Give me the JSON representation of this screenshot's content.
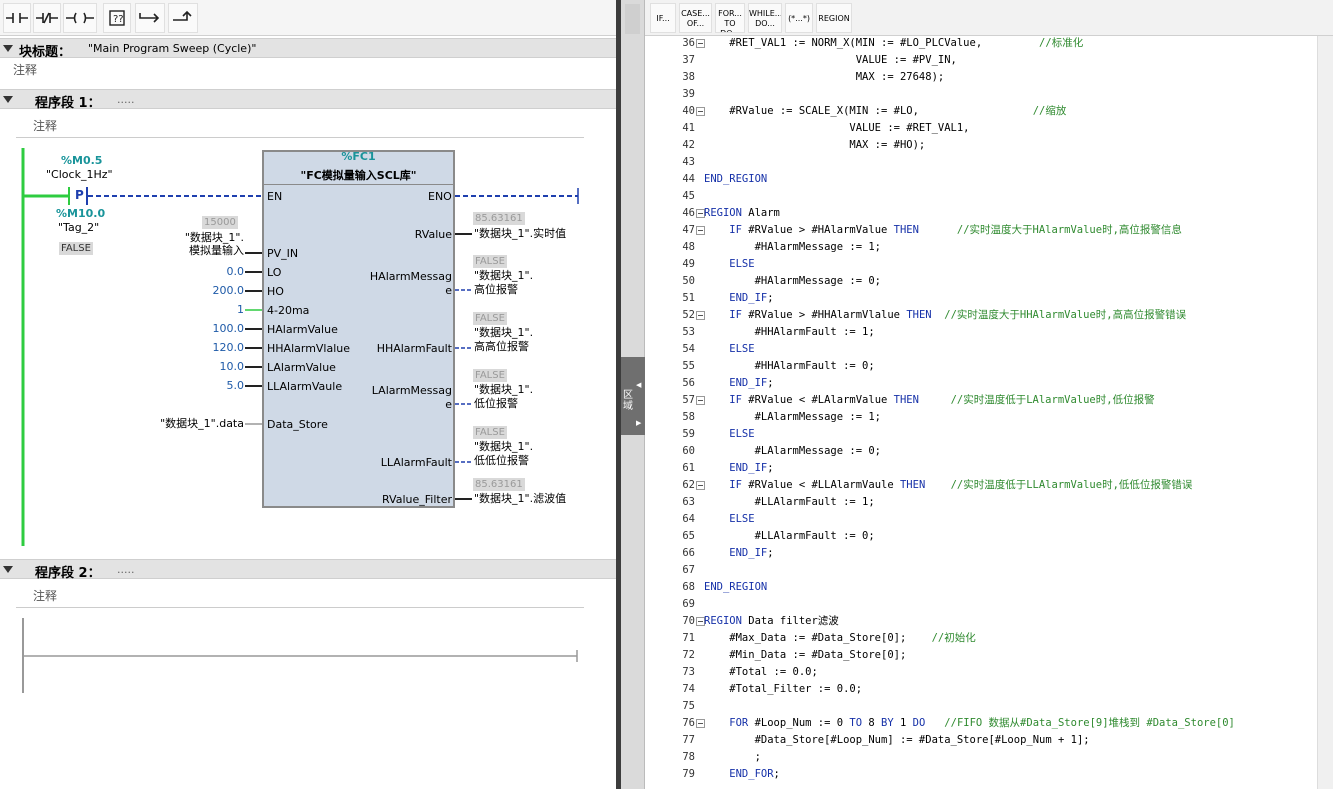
{
  "ladder_toolbar": {
    "icons": [
      "no-contact-icon",
      "nc-contact-icon",
      "coil-icon",
      "empty-box-icon",
      "branch-open-icon",
      "branch-close-icon"
    ]
  },
  "block_title": {
    "label": "块标题：",
    "value": "\"Main Program Sweep (Cycle)\"",
    "comment": "注释"
  },
  "network1": {
    "label": "程序段 1：",
    "dots": ".....",
    "comment": "注释",
    "contact": {
      "address": "%M0.5",
      "name": "\"Clock_1Hz\"",
      "type": "P"
    },
    "edge_mem": {
      "address": "%M10.0",
      "name": "\"Tag_2\"",
      "state": "FALSE"
    },
    "fc": {
      "address": "%FC1",
      "name": "\"FC模拟量输入SCL库\"",
      "en": "EN",
      "eno": "ENO",
      "inputs": [
        {
          "pin": "PV_IN",
          "value_line1": "\"数据块_1\".",
          "value_line2": "模拟量输入",
          "live": "15000"
        },
        {
          "pin": "LO",
          "value": "0.0"
        },
        {
          "pin": "HO",
          "value": "200.0"
        },
        {
          "pin": "4-20ma",
          "value": "1"
        },
        {
          "pin": "HAlarmValue",
          "value": "100.0"
        },
        {
          "pin": "HHAlarmVlalue",
          "value": "120.0"
        },
        {
          "pin": "LAlarmValue",
          "value": "10.0"
        },
        {
          "pin": "LLAlarmVaule",
          "value": "5.0"
        },
        {
          "pin": "Data_Store",
          "value": "\"数据块_1\".data"
        }
      ],
      "outputs": [
        {
          "pin": "RValue",
          "live": "85.63161",
          "line1": "\"数据块_1\".实时值"
        },
        {
          "pin_line1": "HAlarmMessag",
          "pin_line2": "e",
          "live": "FALSE",
          "line1": "\"数据块_1\".",
          "line2": "高位报警"
        },
        {
          "pin": "HHAlarmFault",
          "live": "FALSE",
          "line1": "\"数据块_1\".",
          "line2": "高高位报警"
        },
        {
          "pin_line1": "LAlarmMessag",
          "pin_line2": "e",
          "live": "FALSE",
          "line1": "\"数据块_1\".",
          "line2": "低位报警"
        },
        {
          "pin": "LLAlarmFault",
          "live": "FALSE",
          "line1": "\"数据块_1\".",
          "line2": "低低位报警"
        },
        {
          "pin": "RValue_Filter",
          "live": "85.63161",
          "line1": "\"数据块_1\".滤波值"
        }
      ]
    }
  },
  "network2": {
    "label": "程序段 2：",
    "dots": ".....",
    "comment": "注释"
  },
  "splitter": {
    "label": "区域"
  },
  "scl_toolbar": {
    "buttons": [
      {
        "label1": "IF...",
        "label2": ""
      },
      {
        "label1": "CASE...",
        "label2": "OF..."
      },
      {
        "label1": "FOR...",
        "label2": "TO DO..."
      },
      {
        "label1": "WHILE...",
        "label2": "DO..."
      },
      {
        "label1": "(*...*)",
        "label2": ""
      },
      {
        "label1": "REGION",
        "label2": ""
      }
    ]
  },
  "code": [
    {
      "n": "36",
      "fold": true,
      "segs": [
        [
          "",
          "    #RET_VAL1 := NORM_X(MIN := #LO_PLCValue,         "
        ],
        [
          "cm",
          "//标准化"
        ]
      ]
    },
    {
      "n": "37",
      "segs": [
        [
          "",
          "                        VALUE := #PV_IN,"
        ]
      ]
    },
    {
      "n": "38",
      "segs": [
        [
          "",
          "                        MAX := 27648);"
        ]
      ]
    },
    {
      "n": "39",
      "segs": []
    },
    {
      "n": "40",
      "fold": true,
      "segs": [
        [
          "",
          "    #RValue := SCALE_X(MIN := #LO,                  "
        ],
        [
          "cm",
          "//缩放"
        ]
      ]
    },
    {
      "n": "41",
      "segs": [
        [
          "",
          "                       VALUE := #RET_VAL1,"
        ]
      ]
    },
    {
      "n": "42",
      "segs": [
        [
          "",
          "                       MAX := #HO);"
        ]
      ]
    },
    {
      "n": "43",
      "segs": []
    },
    {
      "n": "44",
      "segs": [
        [
          "kw",
          "END_REGION"
        ]
      ]
    },
    {
      "n": "45",
      "segs": []
    },
    {
      "n": "46",
      "fold": true,
      "segs": [
        [
          "kw",
          "REGION"
        ],
        [
          "",
          " Alarm"
        ]
      ]
    },
    {
      "n": "47",
      "fold": true,
      "segs": [
        [
          "kw",
          "    IF"
        ],
        [
          "",
          " #RValue > #HAlarmValue "
        ],
        [
          "kw",
          "THEN"
        ],
        [
          "",
          "      "
        ],
        [
          "cm",
          "//实时温度大于HAlarmValue时,高位报警信息"
        ]
      ]
    },
    {
      "n": "48",
      "segs": [
        [
          "",
          "        #HAlarmMessage := 1;"
        ]
      ]
    },
    {
      "n": "49",
      "segs": [
        [
          "kw",
          "    ELSE"
        ]
      ]
    },
    {
      "n": "50",
      "segs": [
        [
          "",
          "        #HAlarmMessage := 0;"
        ]
      ]
    },
    {
      "n": "51",
      "segs": [
        [
          "kw",
          "    END_IF"
        ],
        [
          "",
          ";"
        ]
      ]
    },
    {
      "n": "52",
      "fold": true,
      "segs": [
        [
          "kw",
          "    IF"
        ],
        [
          "",
          " #RValue > #HHAlarmVlalue "
        ],
        [
          "kw",
          "THEN"
        ],
        [
          "",
          "  "
        ],
        [
          "cm",
          "//实时温度大于HHAlarmValue时,高高位报警错误"
        ]
      ]
    },
    {
      "n": "53",
      "segs": [
        [
          "",
          "        #HHAlarmFault := 1;"
        ]
      ]
    },
    {
      "n": "54",
      "segs": [
        [
          "kw",
          "    ELSE"
        ]
      ]
    },
    {
      "n": "55",
      "segs": [
        [
          "",
          "        #HHAlarmFault := 0;"
        ]
      ]
    },
    {
      "n": "56",
      "segs": [
        [
          "kw",
          "    END_IF"
        ],
        [
          "",
          ";"
        ]
      ]
    },
    {
      "n": "57",
      "fold": true,
      "segs": [
        [
          "kw",
          "    IF"
        ],
        [
          "",
          " #RValue < #LAlarmValue "
        ],
        [
          "kw",
          "THEN"
        ],
        [
          "",
          "     "
        ],
        [
          "cm",
          "//实时温度低于LAlarmValue时,低位报警"
        ]
      ]
    },
    {
      "n": "58",
      "segs": [
        [
          "",
          "        #LAlarmMessage := 1;"
        ]
      ]
    },
    {
      "n": "59",
      "segs": [
        [
          "kw",
          "    ELSE"
        ]
      ]
    },
    {
      "n": "60",
      "segs": [
        [
          "",
          "        #LAlarmMessage := 0;"
        ]
      ]
    },
    {
      "n": "61",
      "segs": [
        [
          "kw",
          "    END_IF"
        ],
        [
          "",
          ";"
        ]
      ]
    },
    {
      "n": "62",
      "fold": true,
      "segs": [
        [
          "kw",
          "    IF"
        ],
        [
          "",
          " #RValue < #LLAlarmVaule "
        ],
        [
          "kw",
          "THEN"
        ],
        [
          "",
          "    "
        ],
        [
          "cm",
          "//实时温度低于LLAlarmValue时,低低位报警错误"
        ]
      ]
    },
    {
      "n": "63",
      "segs": [
        [
          "",
          "        #LLAlarmFault := 1;"
        ]
      ]
    },
    {
      "n": "64",
      "segs": [
        [
          "kw",
          "    ELSE"
        ]
      ]
    },
    {
      "n": "65",
      "segs": [
        [
          "",
          "        #LLAlarmFault := 0;"
        ]
      ]
    },
    {
      "n": "66",
      "segs": [
        [
          "kw",
          "    END_IF"
        ],
        [
          "",
          ";"
        ]
      ]
    },
    {
      "n": "67",
      "segs": []
    },
    {
      "n": "68",
      "segs": [
        [
          "kw",
          "END_REGION"
        ]
      ]
    },
    {
      "n": "69",
      "segs": []
    },
    {
      "n": "70",
      "fold": true,
      "segs": [
        [
          "kw",
          "REGION"
        ],
        [
          "",
          " Data filter滤波"
        ]
      ]
    },
    {
      "n": "71",
      "segs": [
        [
          "",
          "    #Max_Data := #Data_Store[0];    "
        ],
        [
          "cm",
          "//初始化"
        ]
      ]
    },
    {
      "n": "72",
      "segs": [
        [
          "",
          "    #Min_Data := #Data_Store[0];"
        ]
      ]
    },
    {
      "n": "73",
      "segs": [
        [
          "",
          "    #Total := 0.0;"
        ]
      ]
    },
    {
      "n": "74",
      "segs": [
        [
          "",
          "    #Total_Filter := 0.0;"
        ]
      ]
    },
    {
      "n": "75",
      "segs": []
    },
    {
      "n": "76",
      "fold": true,
      "segs": [
        [
          "kw",
          "    FOR"
        ],
        [
          "",
          " #Loop_Num := 0 "
        ],
        [
          "kw",
          "TO"
        ],
        [
          "",
          " 8 "
        ],
        [
          "kw",
          "BY"
        ],
        [
          "",
          " 1 "
        ],
        [
          "kw",
          "DO"
        ],
        [
          "",
          "   "
        ],
        [
          "cm",
          "//FIFO 数据从#Data_Store[9]堆栈到 #Data_Store[0]"
        ]
      ]
    },
    {
      "n": "77",
      "segs": [
        [
          "",
          "        #Data_Store[#Loop_Num] := #Data_Store[#Loop_Num + 1];"
        ]
      ]
    },
    {
      "n": "78",
      "segs": [
        [
          "",
          "        ;"
        ]
      ]
    },
    {
      "n": "79",
      "segs": [
        [
          "kw",
          "    END_FOR"
        ],
        [
          "",
          ";"
        ]
      ]
    }
  ],
  "colors": {
    "keyword": "#1530a8",
    "comment": "#2f8a2f",
    "rail": "#2ecc40",
    "teal": "#19949a",
    "value_blue": "#1e5aa8"
  }
}
